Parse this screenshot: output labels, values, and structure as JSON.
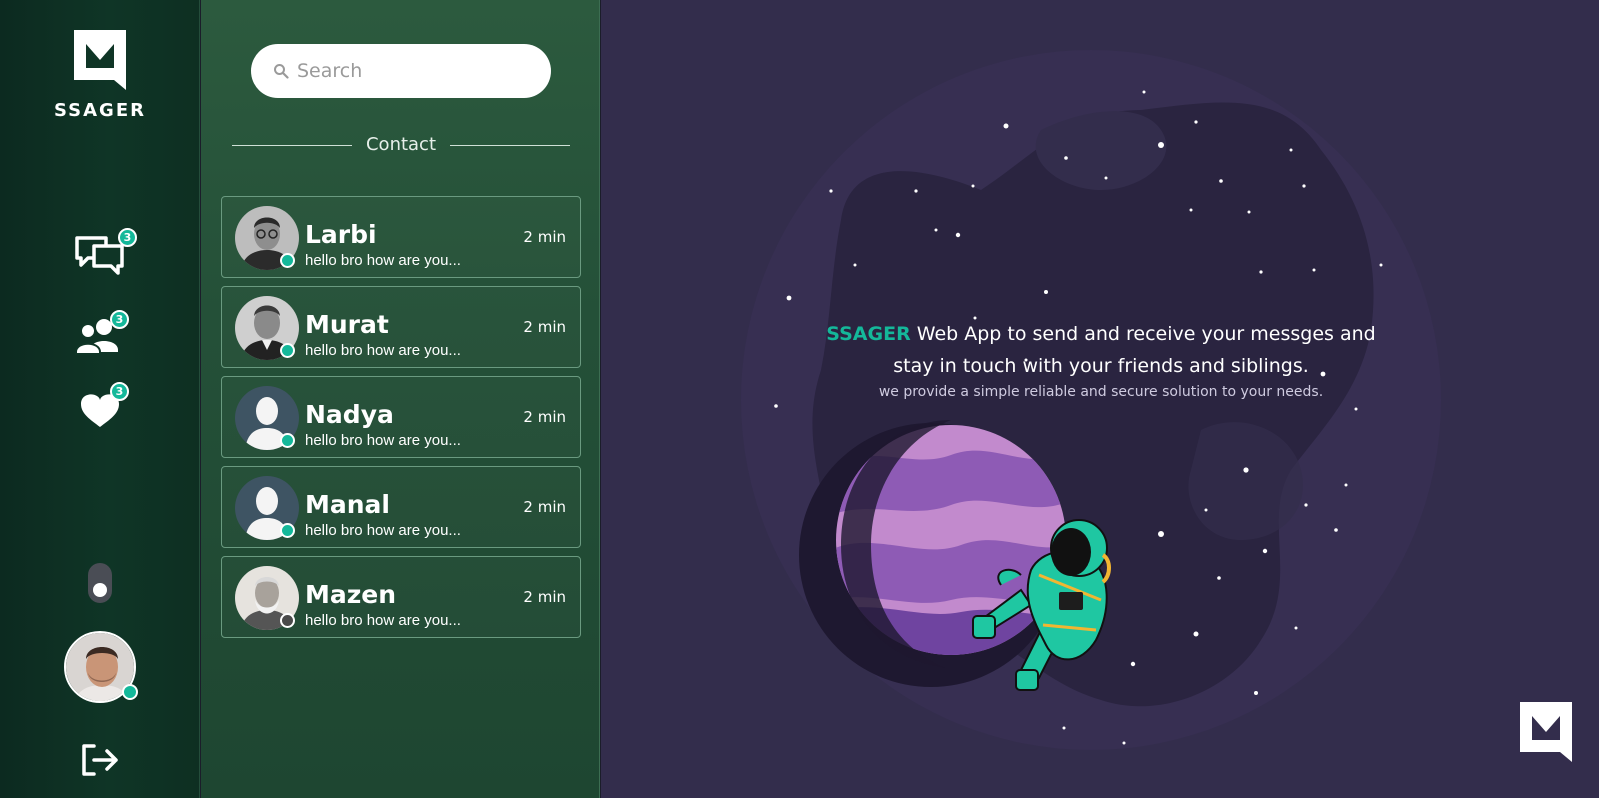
{
  "app": {
    "brand": "SSAGER",
    "accent_color": "#14b89a"
  },
  "sidebar": {
    "nav": [
      {
        "id": "chats",
        "icon": "chat-bubbles-icon",
        "badge": "3"
      },
      {
        "id": "contacts",
        "icon": "users-icon",
        "badge": "3"
      },
      {
        "id": "favorites",
        "icon": "heart-icon",
        "badge": "3"
      }
    ],
    "theme_toggle_icon": "toggle-switch",
    "profile_status": "online",
    "logout_icon": "logout-icon"
  },
  "contacts_panel": {
    "search": {
      "placeholder": "Search",
      "value": ""
    },
    "section_title": "Contact",
    "items": [
      {
        "name": "Larbi",
        "time": "2 min",
        "preview": "hello bro how are you...",
        "status": "online"
      },
      {
        "name": "Murat",
        "time": "2 min",
        "preview": "hello bro how are you...",
        "status": "online"
      },
      {
        "name": "Nadya",
        "time": "2 min",
        "preview": "hello bro how are you...",
        "status": "online"
      },
      {
        "name": "Manal",
        "time": "2 min",
        "preview": "hello bro how are you...",
        "status": "online"
      },
      {
        "name": "Mazen",
        "time": "2 min",
        "preview": "hello bro how are you...",
        "status": "offline"
      }
    ],
    "status_colors": {
      "online": "#14b89a",
      "offline": "#4a4a4a"
    }
  },
  "main": {
    "welcome_brand": "SSAGER",
    "welcome_text": "Web App to send and receive your messges and stay in touch with your friends and siblings.",
    "welcome_sub": "we provide a simple reliable and secure solution to your needs."
  }
}
